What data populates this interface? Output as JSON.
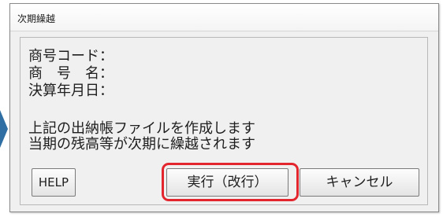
{
  "window": {
    "title": "次期繰越"
  },
  "info": {
    "code_label": "商号コード：",
    "name_label": "商　号　名：",
    "date_label": "決算年月日："
  },
  "message": {
    "line1": "上記の出納帳ファイルを作成します",
    "line2": "当期の残高等が次期に繰越されます"
  },
  "buttons": {
    "help_label": "HELP",
    "execute_label": "実行（改行）",
    "cancel_label": "キャンセル"
  },
  "colors": {
    "highlight": "#e3262e",
    "arrow": "#2f6fa3"
  }
}
